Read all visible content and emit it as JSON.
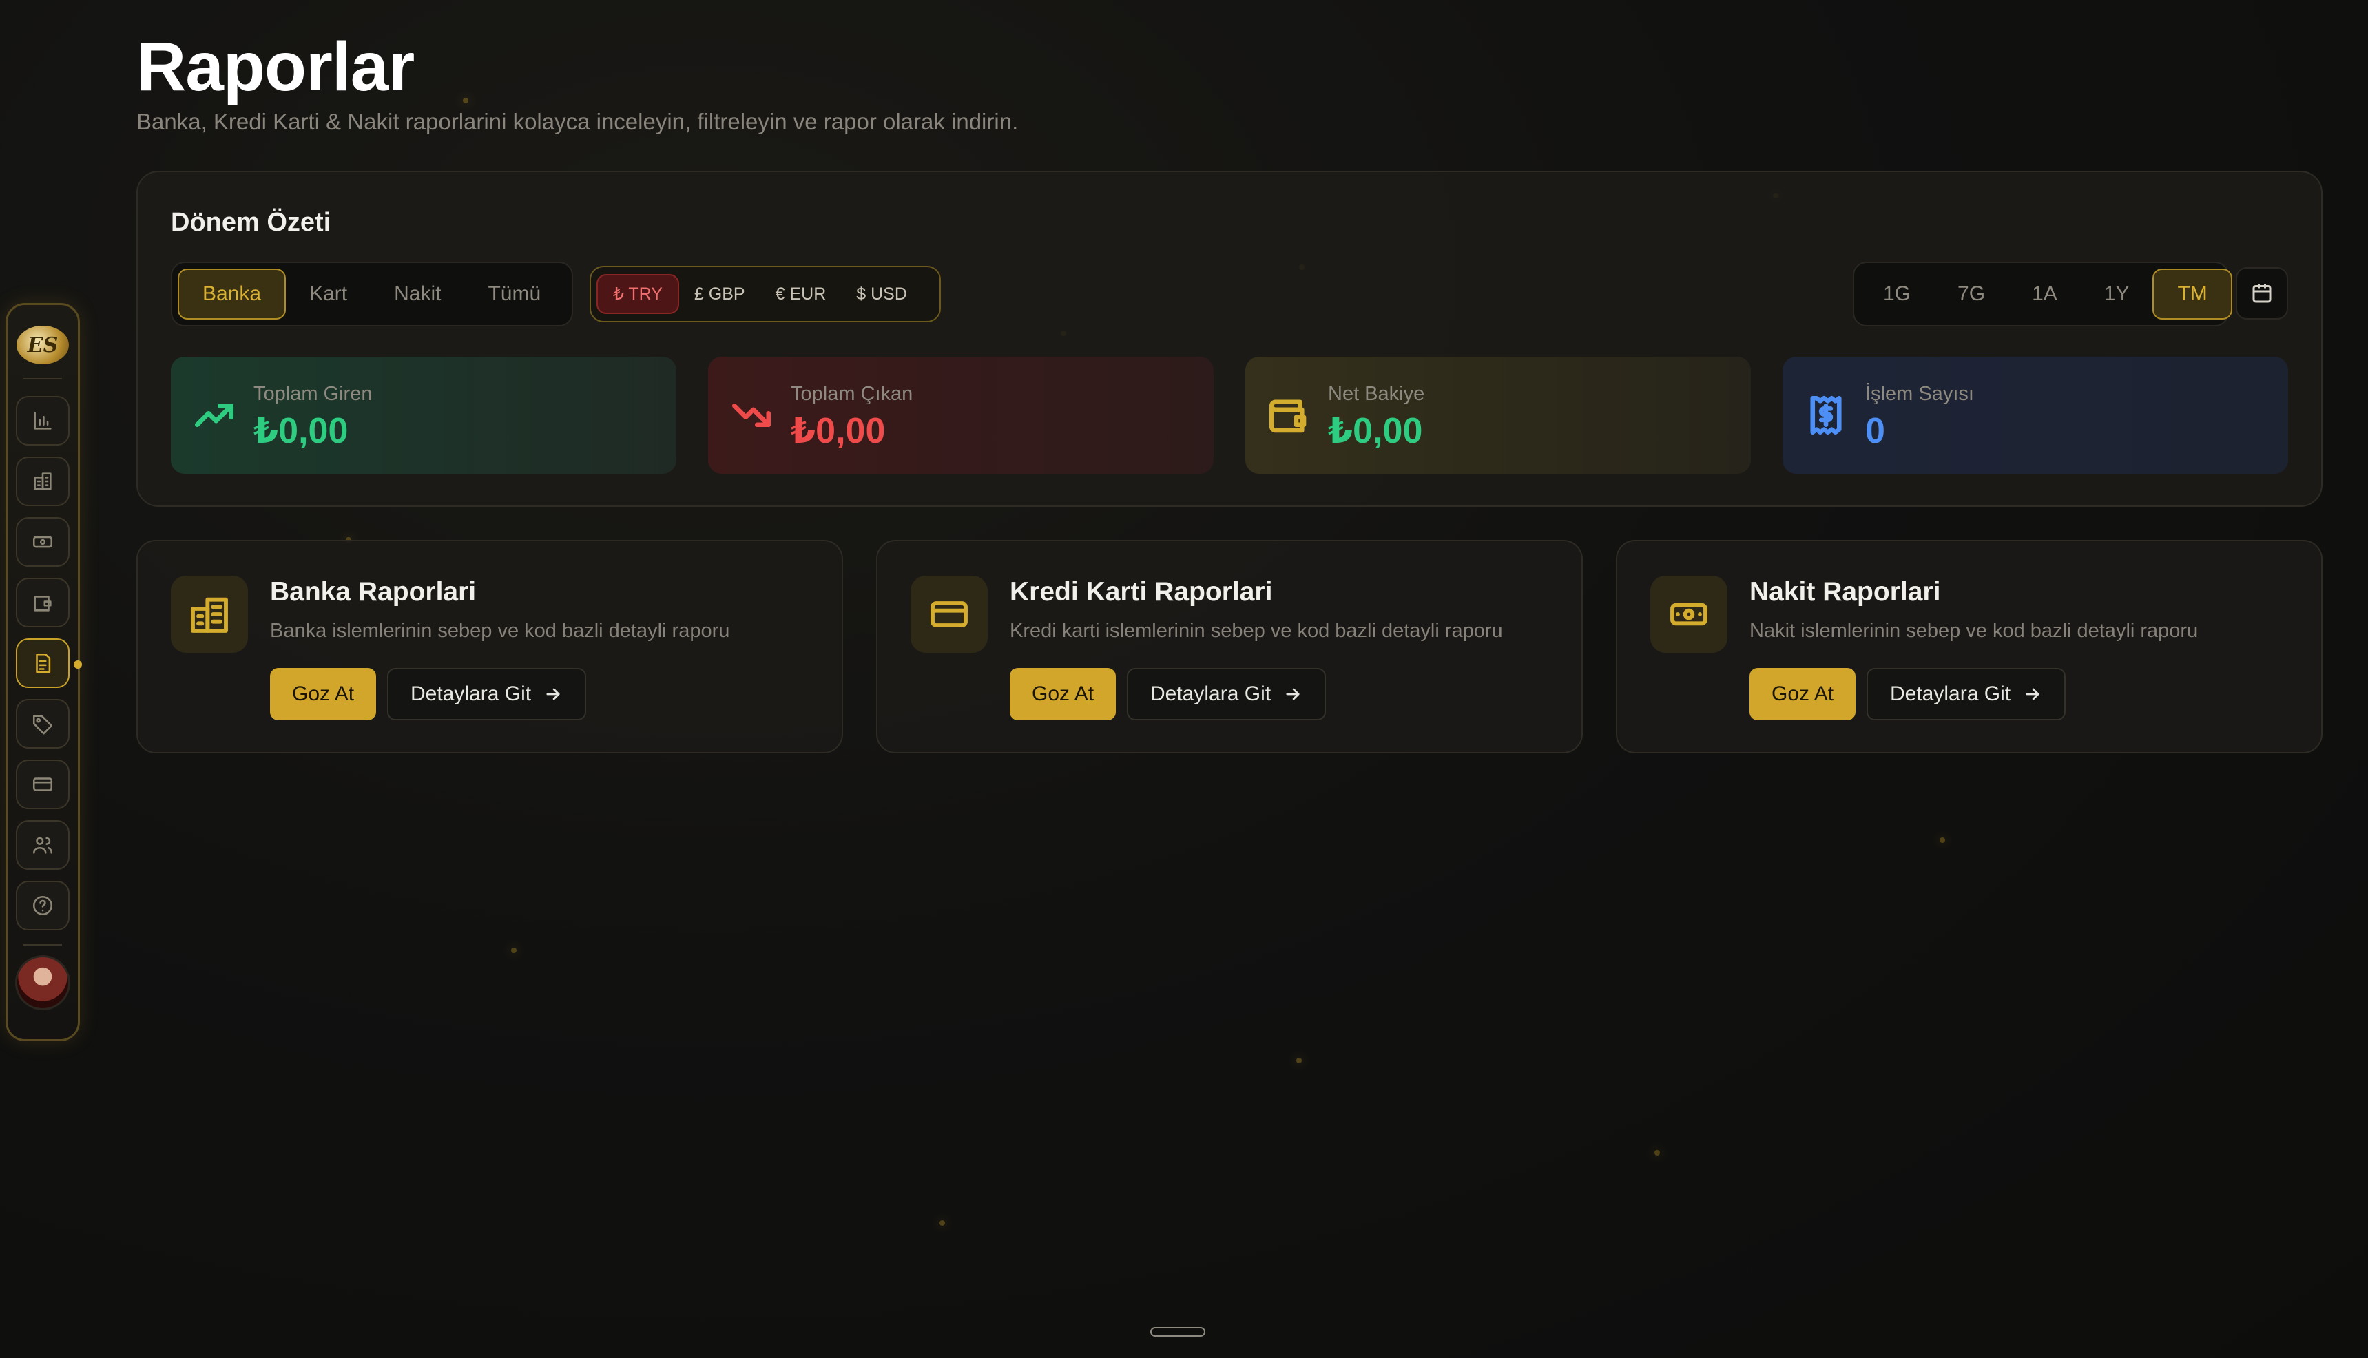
{
  "header": {
    "title": "Raporlar",
    "subtitle": "Banka, Kredi Karti & Nakit raporlarini kolayca inceleyin, filtreleyin ve rapor olarak indirin."
  },
  "sidebar": {
    "logo_text": "ES",
    "items": [
      {
        "icon": "bar-chart-icon"
      },
      {
        "icon": "building-icon"
      },
      {
        "icon": "banknote-icon"
      },
      {
        "icon": "wallet-icon"
      },
      {
        "icon": "file-report-icon",
        "active": true
      },
      {
        "icon": "tag-icon"
      },
      {
        "icon": "credit-card-icon"
      },
      {
        "icon": "users-icon"
      },
      {
        "icon": "help-circle-icon"
      }
    ]
  },
  "period": {
    "title": "Dönem Özeti",
    "type_tabs": [
      "Banka",
      "Kart",
      "Nakit",
      "Tümü"
    ],
    "type_selected": "Banka",
    "currencies": [
      "₺ TRY",
      "£ GBP",
      "€ EUR",
      "$ USD"
    ],
    "currency_selected": "₺ TRY",
    "ranges": [
      "1G",
      "7G",
      "1A",
      "1Y",
      "TM"
    ],
    "range_selected": "TM",
    "stats": {
      "in": {
        "label": "Toplam Giren",
        "value": "₺0,00"
      },
      "out": {
        "label": "Toplam Çıkan",
        "value": "₺0,00"
      },
      "net": {
        "label": "Net Bakiye",
        "value": "₺0,00"
      },
      "count": {
        "label": "İşlem Sayısı",
        "value": "0"
      }
    }
  },
  "reports": [
    {
      "title": "Banka Raporlari",
      "desc": "Banka islemlerinin sebep ve kod bazli detayli raporu",
      "primary": "Goz At",
      "secondary": "Detaylara Git"
    },
    {
      "title": "Kredi Karti Raporlari",
      "desc": "Kredi karti islemlerinin sebep ve kod bazli detayli raporu",
      "primary": "Goz At",
      "secondary": "Detaylara Git"
    },
    {
      "title": "Nakit Raporlari",
      "desc": "Nakit islemlerinin sebep ve kod bazli detayli raporu",
      "primary": "Goz At",
      "secondary": "Detaylara Git"
    }
  ],
  "colors": {
    "accent": "#d1a62a",
    "green": "#2ecc80",
    "red": "#ef4b4b",
    "blue": "#4d8ff5"
  }
}
